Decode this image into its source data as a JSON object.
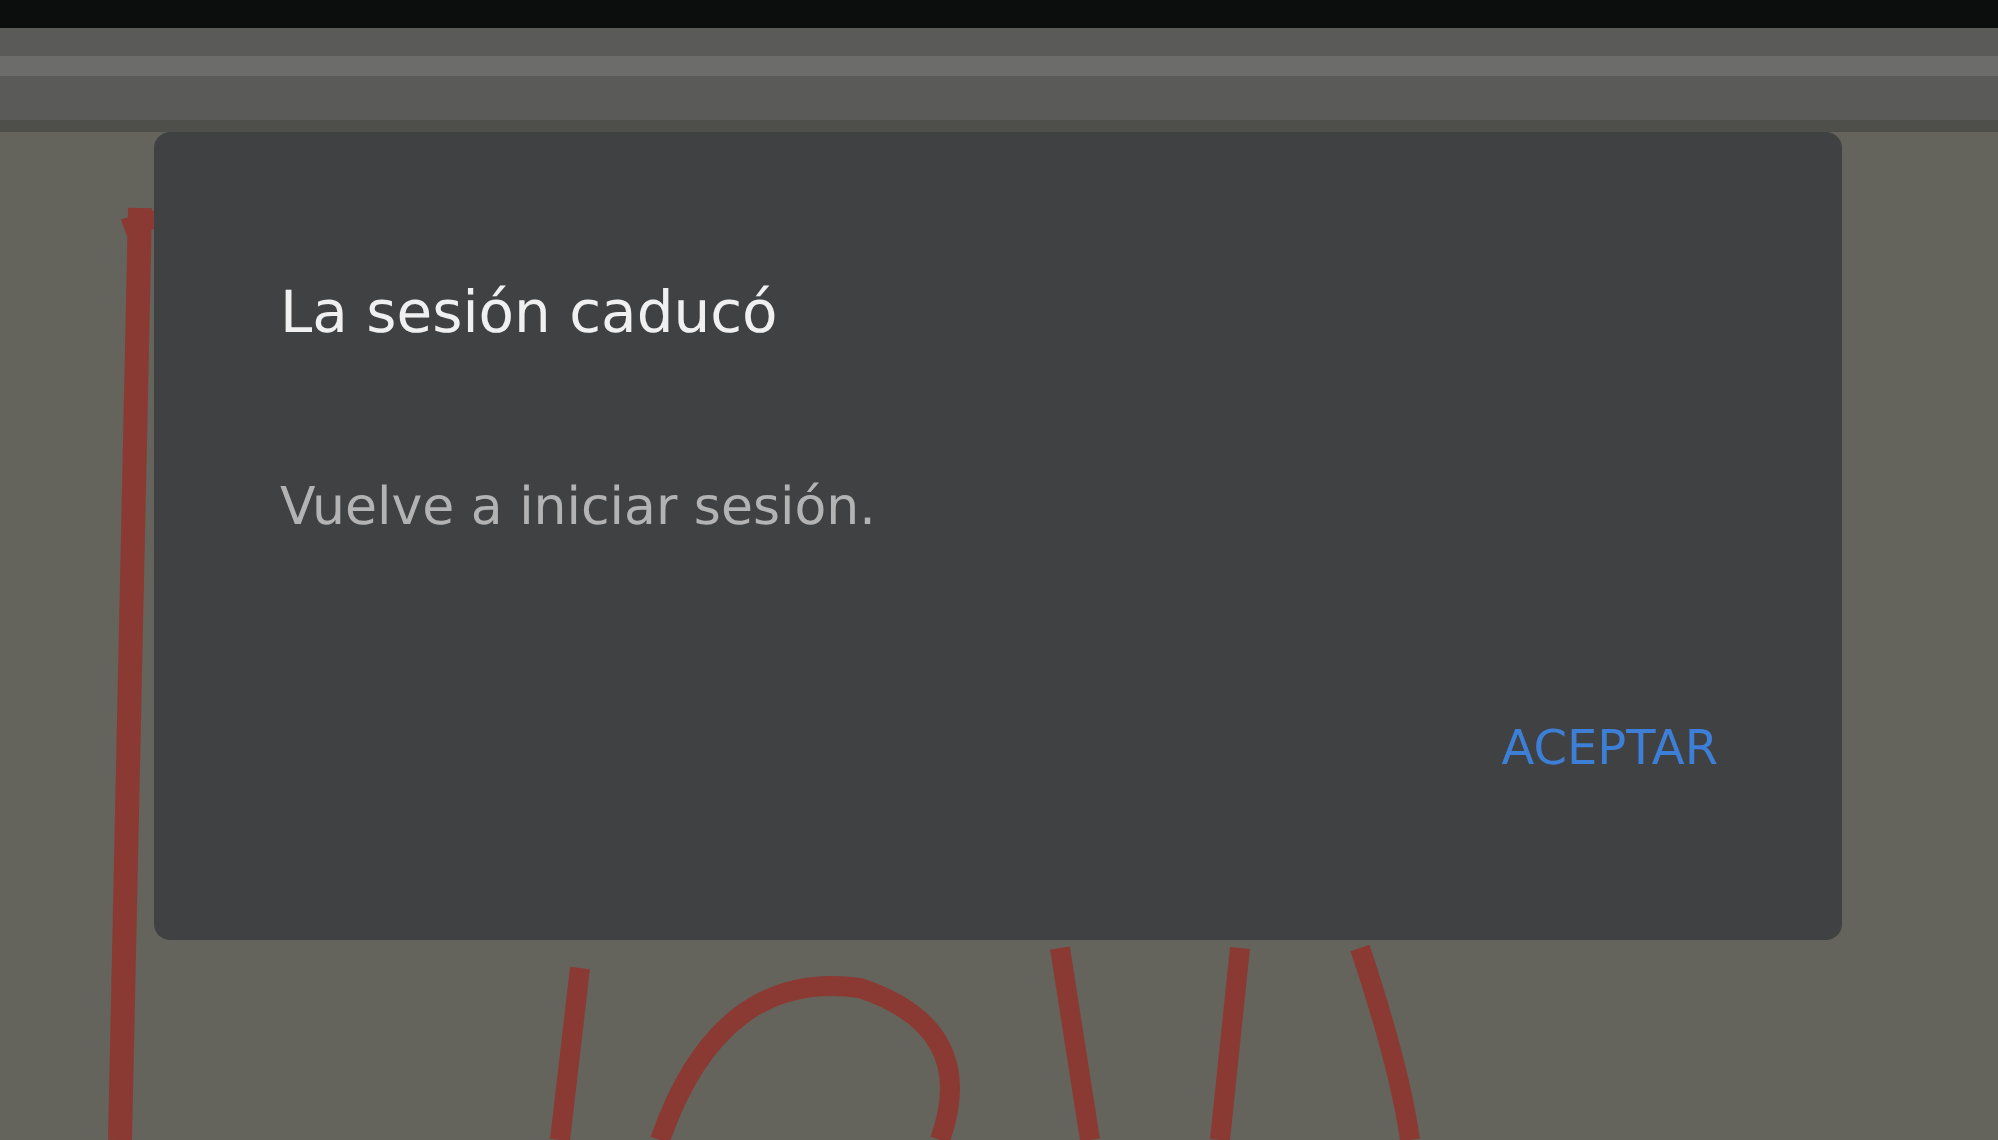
{
  "dialog": {
    "title": "La sesión caducó",
    "message": "Vuelve a iniciar sesión.",
    "buttons": [
      "ACEPTAR"
    ]
  }
}
